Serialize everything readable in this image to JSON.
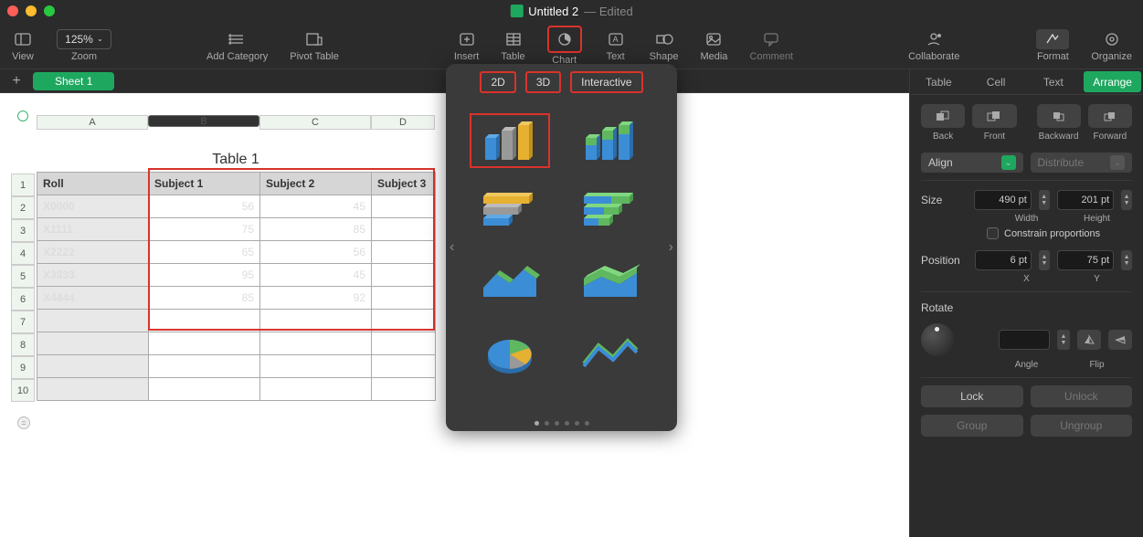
{
  "title": {
    "name": "Untitled 2",
    "status": "Edited"
  },
  "toolbar": {
    "view": "View",
    "zoom": "Zoom",
    "zoom_value": "125%",
    "add_category": "Add Category",
    "pivot": "Pivot Table",
    "insert": "Insert",
    "table": "Table",
    "chart": "Chart",
    "text": "Text",
    "shape": "Shape",
    "media": "Media",
    "comment": "Comment",
    "collaborate": "Collaborate",
    "format": "Format",
    "organize": "Organize"
  },
  "tabs": {
    "sheet1": "Sheet 1"
  },
  "chart_popover": {
    "tabs": {
      "d2": "2D",
      "d3": "3D",
      "interactive": "Interactive"
    },
    "thumbs": [
      "bar-3d-vertical",
      "bar-3d-stacked",
      "bar-3d-horizontal",
      "bar-3d-horizontal-stacked",
      "area-3d",
      "area-3d-stacked",
      "pie-3d",
      "line-3d"
    ]
  },
  "sheet": {
    "columns": [
      "A",
      "B",
      "C",
      "D"
    ],
    "rows": [
      "1",
      "2",
      "3",
      "4",
      "5",
      "6",
      "7",
      "8",
      "9",
      "10"
    ],
    "table_title": "Table 1",
    "headers": [
      "Roll",
      "Subject 1",
      "Subject 2",
      "Subject 3"
    ]
  },
  "chart_data": {
    "type": "table",
    "columns": [
      "Roll",
      "Subject 1",
      "Subject 2",
      "Subject 3"
    ],
    "rows": [
      {
        "Roll": "X0000",
        "Subject 1": 56,
        "Subject 2": 45,
        "Subject 3": null
      },
      {
        "Roll": "X1111",
        "Subject 1": 75,
        "Subject 2": 85,
        "Subject 3": null
      },
      {
        "Roll": "X2222",
        "Subject 1": 65,
        "Subject 2": 56,
        "Subject 3": null
      },
      {
        "Roll": "X3333",
        "Subject 1": 95,
        "Subject 2": 45,
        "Subject 3": null
      },
      {
        "Roll": "X4444",
        "Subject 1": 85,
        "Subject 2": 92,
        "Subject 3": null
      }
    ]
  },
  "sidebar": {
    "tabs": {
      "table": "Table",
      "cell": "Cell",
      "text": "Text",
      "arrange": "Arrange"
    },
    "layer": {
      "back": "Back",
      "front": "Front",
      "backward": "Backward",
      "forward": "Forward"
    },
    "align": "Align",
    "distribute": "Distribute",
    "size_label": "Size",
    "width_val": "490 pt",
    "height_val": "201 pt",
    "width_lbl": "Width",
    "height_lbl": "Height",
    "constrain": "Constrain proportions",
    "position_label": "Position",
    "x_val": "6 pt",
    "y_val": "75 pt",
    "x_lbl": "X",
    "y_lbl": "Y",
    "rotate": "Rotate",
    "angle": "Angle",
    "flip": "Flip",
    "lock": "Lock",
    "unlock": "Unlock",
    "group": "Group",
    "ungroup": "Ungroup"
  }
}
